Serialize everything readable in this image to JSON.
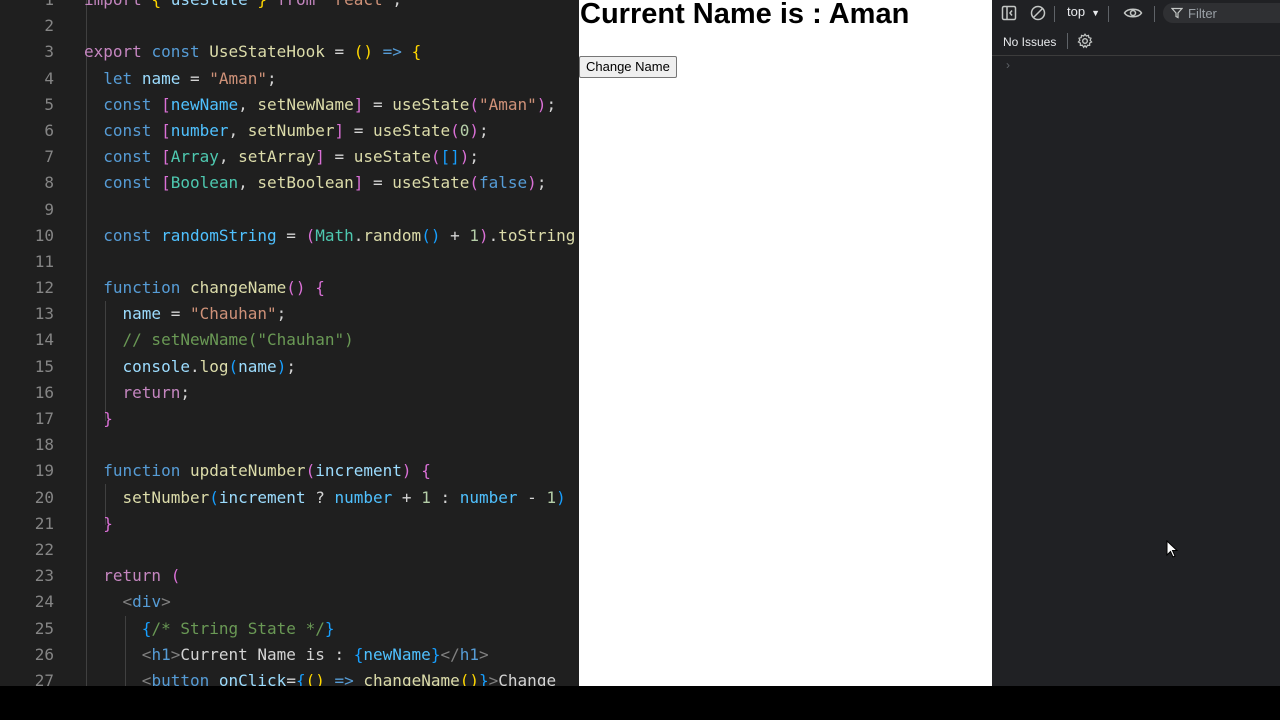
{
  "editor": {
    "lines": [
      {
        "n": "1",
        "html": "<span class=\"kw2\">import</span> <span class=\"br1\">{</span> <span class=\"var\">useState</span> <span class=\"br1\">}</span> <span class=\"kw2\">from</span> <span class=\"str\">\"react\"</span>;"
      },
      {
        "n": "2",
        "html": ""
      },
      {
        "n": "3",
        "html": "<span class=\"kw2\">export</span> <span class=\"kw\">const</span> <span class=\"fn\">UseStateHook</span> = <span class=\"br1\">()</span> <span class=\"kw\">=&gt;</span> <span class=\"br1\">{</span>"
      },
      {
        "n": "4",
        "html": "  <span class=\"kw\">let</span> <span class=\"var\">name</span> = <span class=\"str\">\"Aman\"</span>;"
      },
      {
        "n": "5",
        "html": "  <span class=\"kw\">const</span> <span class=\"br2\">[</span><span class=\"cst\">newName</span>, <span class=\"fn\">setNewName</span><span class=\"br2\">]</span> = <span class=\"fn\">useState</span><span class=\"br2\">(</span><span class=\"str\">\"Aman\"</span><span class=\"br2\">)</span>;"
      },
      {
        "n": "6",
        "html": "  <span class=\"kw\">const</span> <span class=\"br2\">[</span><span class=\"cst\">number</span>, <span class=\"fn\">setNumber</span><span class=\"br2\">]</span> = <span class=\"fn\">useState</span><span class=\"br2\">(</span><span class=\"num\">0</span><span class=\"br2\">)</span>;"
      },
      {
        "n": "7",
        "html": "  <span class=\"kw\">const</span> <span class=\"br2\">[</span><span class=\"cls\">Array</span>, <span class=\"fn\">setArray</span><span class=\"br2\">]</span> = <span class=\"fn\">useState</span><span class=\"br2\">(</span><span class=\"br3\">[]</span><span class=\"br2\">)</span>;"
      },
      {
        "n": "8",
        "html": "  <span class=\"kw\">const</span> <span class=\"br2\">[</span><span class=\"cls\">Boolean</span>, <span class=\"fn\">setBoolean</span><span class=\"br2\">]</span> = <span class=\"fn\">useState</span><span class=\"br2\">(</span><span class=\"kw\">false</span><span class=\"br2\">)</span>;"
      },
      {
        "n": "9",
        "html": ""
      },
      {
        "n": "10",
        "html": "  <span class=\"kw\">const</span> <span class=\"cst\">randomString</span> = <span class=\"br2\">(</span><span class=\"cls\">Math</span>.<span class=\"fn\">random</span><span class=\"br3\">()</span> + <span class=\"num\">1</span><span class=\"br2\">)</span>.<span class=\"fn\">toString</span>"
      },
      {
        "n": "11",
        "html": ""
      },
      {
        "n": "12",
        "html": "  <span class=\"kw\">function</span> <span class=\"fn\">changeName</span><span class=\"br2\">()</span> <span class=\"br2\">{</span>"
      },
      {
        "n": "13",
        "html": "    <span class=\"var\">name</span> = <span class=\"str\">\"Chauhan\"</span>;"
      },
      {
        "n": "14",
        "html": "    <span class=\"cmt\">// setNewName(\"Chauhan\")</span>"
      },
      {
        "n": "15",
        "html": "    <span class=\"var\">console</span>.<span class=\"fn\">log</span><span class=\"br3\">(</span><span class=\"var\">name</span><span class=\"br3\">)</span>;"
      },
      {
        "n": "16",
        "html": "    <span class=\"kw2\">return</span>;"
      },
      {
        "n": "17",
        "html": "  <span class=\"br2\">}</span>"
      },
      {
        "n": "18",
        "html": ""
      },
      {
        "n": "19",
        "html": "  <span class=\"kw\">function</span> <span class=\"fn\">updateNumber</span><span class=\"br2\">(</span><span class=\"var\">increment</span><span class=\"br2\">)</span> <span class=\"br2\">{</span>"
      },
      {
        "n": "20",
        "html": "    <span class=\"fn\">setNumber</span><span class=\"br3\">(</span><span class=\"var\">increment</span> ? <span class=\"cst\">number</span> + <span class=\"num\">1</span> : <span class=\"cst\">number</span> - <span class=\"num\">1</span><span class=\"br3\">)</span>"
      },
      {
        "n": "21",
        "html": "  <span class=\"br2\">}</span>"
      },
      {
        "n": "22",
        "html": ""
      },
      {
        "n": "23",
        "html": "  <span class=\"kw2\">return</span> <span class=\"br2\">(</span>"
      },
      {
        "n": "24",
        "html": "    <span class=\"tag\">&lt;</span><span class=\"tagn\">div</span><span class=\"tag\">&gt;</span>"
      },
      {
        "n": "25",
        "html": "      <span class=\"br3\">{</span><span class=\"cmt\">/* String State */</span><span class=\"br3\">}</span>"
      },
      {
        "n": "26",
        "html": "      <span class=\"tag\">&lt;</span><span class=\"tagn\">h1</span><span class=\"tag\">&gt;</span>Current Name is : <span class=\"br3\">{</span><span class=\"cst\">newName</span><span class=\"br3\">}</span><span class=\"tag\">&lt;/</span><span class=\"tagn\">h1</span><span class=\"tag\">&gt;</span>"
      },
      {
        "n": "27",
        "html": "      <span class=\"tag\">&lt;</span><span class=\"tagn\">button</span> <span class=\"var\">onClick</span>=<span class=\"br3\">{</span><span class=\"br1\">()</span> <span class=\"kw\">=&gt;</span> <span class=\"fn\">changeName</span><span class=\"br1\">()</span><span class=\"br3\">}</span><span class=\"tag\">&gt;</span>Change"
      }
    ]
  },
  "viewport": {
    "heading": "Current Name is : Aman",
    "button_label": "Change Name"
  },
  "devtools": {
    "context": "top",
    "filter_placeholder": "Filter",
    "issues_label": "No Issues"
  },
  "colors": {
    "editor_bg": "#1f1f1f",
    "devtools_bg": "#202124",
    "viewport_bg": "#ffffff"
  },
  "icons": [
    "sidebar-toggle-icon",
    "clear-console-icon",
    "context-caret-icon",
    "live-expression-eye-icon",
    "filter-icon",
    "settings-gear-icon",
    "console-prompt-chevron-icon",
    "mouse-cursor-icon"
  ]
}
